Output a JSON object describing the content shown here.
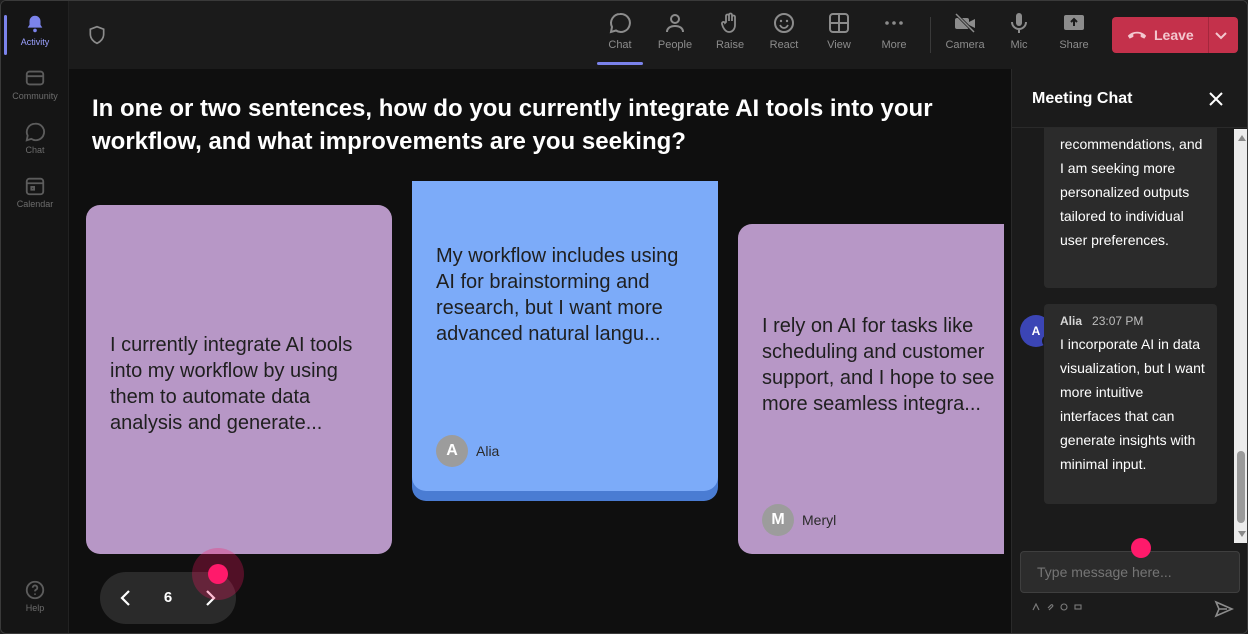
{
  "rail": {
    "items": [
      {
        "label": "Activity",
        "icon": "bell-icon",
        "active": true
      },
      {
        "label": "Community",
        "icon": "community-icon"
      },
      {
        "label": "Chat",
        "icon": "chat-icon"
      },
      {
        "label": "Calendar",
        "icon": "calendar-icon"
      }
    ],
    "help": {
      "label": "Help",
      "icon": "help-icon"
    }
  },
  "toolbar": {
    "chat": "Chat",
    "people": "People",
    "raise": "Raise",
    "react": "React",
    "view": "View",
    "more": "More",
    "camera": "Camera",
    "mic": "Mic",
    "share": "Share",
    "leave": "Leave"
  },
  "main": {
    "question": "In one or two sentences, how do you currently integrate AI tools into your workflow, and what improvements are you seeking?",
    "cards": [
      {
        "text": "I currently integrate AI tools into my workflow by using them to automate data analysis and generate...",
        "author": "",
        "initial": "",
        "color": "#b797c6"
      },
      {
        "text": "My workflow includes using AI for brainstorming and research, but I want more advanced natural langu...",
        "author": "Alia",
        "initial": "A",
        "color": "#7cabf9"
      },
      {
        "text": "I rely on AI for tasks like scheduling and customer support, and I hope to see more seamless integra...",
        "author": "Meryl",
        "initial": "M",
        "color": "#b797c6"
      }
    ],
    "pager": {
      "page": "6"
    }
  },
  "chat": {
    "title": "Meeting Chat",
    "messages": [
      {
        "author": "",
        "time": "",
        "text": "recommendations, and I am seeking more personalized outputs tailored to individual user preferences."
      },
      {
        "author": "Alia",
        "initial": "A",
        "time": "23:07 PM",
        "text": "I incorporate AI in data visualization, but I want more intuitive interfaces that can generate insights with minimal input."
      }
    ],
    "input_placeholder": "Type message here..."
  },
  "colors": {
    "accent": "#7b83eb",
    "leave": "#c4314b",
    "card_purple": "#b797c6",
    "card_blue": "#7cabf9",
    "cursor": "#ff1a6b"
  }
}
